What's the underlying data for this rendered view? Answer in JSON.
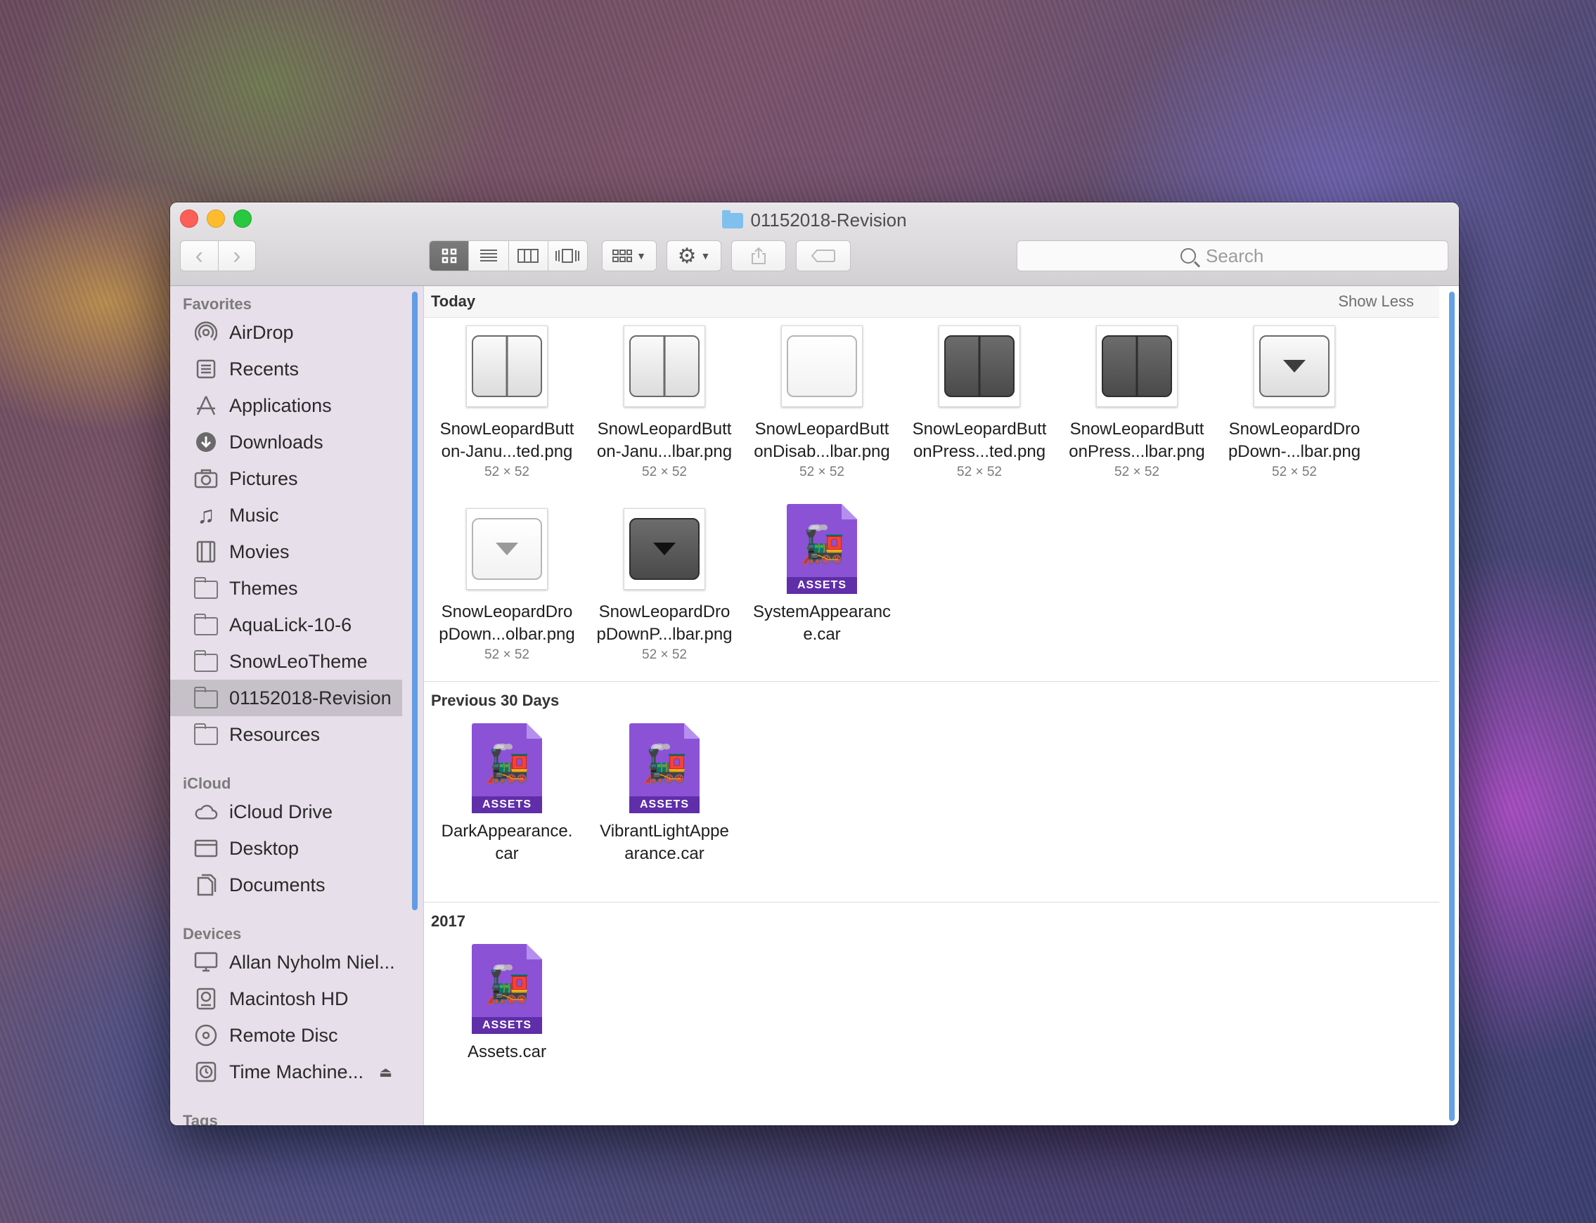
{
  "window": {
    "title": "01152018-Revision"
  },
  "toolbar": {
    "back_label": "‹",
    "forward_label": "›",
    "search_placeholder": "Search"
  },
  "sidebar": {
    "favorites_heading": "Favorites",
    "favorites": [
      {
        "label": "AirDrop",
        "icon": "airdrop-icon"
      },
      {
        "label": "Recents",
        "icon": "recents-icon"
      },
      {
        "label": "Applications",
        "icon": "applications-icon"
      },
      {
        "label": "Downloads",
        "icon": "downloads-icon"
      },
      {
        "label": "Pictures",
        "icon": "camera-icon"
      },
      {
        "label": "Music",
        "icon": "music-icon"
      },
      {
        "label": "Movies",
        "icon": "film-icon"
      },
      {
        "label": "Themes",
        "icon": "folder-icon"
      },
      {
        "label": "AquaLick-10-6",
        "icon": "folder-icon"
      },
      {
        "label": "SnowLeoTheme",
        "icon": "folder-icon"
      },
      {
        "label": "01152018-Revision",
        "icon": "folder-icon",
        "selected": true
      },
      {
        "label": "Resources",
        "icon": "folder-icon"
      }
    ],
    "icloud_heading": "iCloud",
    "icloud": [
      {
        "label": "iCloud Drive",
        "icon": "cloud-icon"
      },
      {
        "label": "Desktop",
        "icon": "desktop-icon"
      },
      {
        "label": "Documents",
        "icon": "documents-icon"
      }
    ],
    "devices_heading": "Devices",
    "devices": [
      {
        "label": "Allan Nyholm Niel...",
        "icon": "computer-icon"
      },
      {
        "label": "Macintosh HD",
        "icon": "hard-drive-icon"
      },
      {
        "label": "Remote Disc",
        "icon": "disc-icon"
      },
      {
        "label": "Time Machine...",
        "icon": "time-machine-icon"
      }
    ],
    "tags_heading": "Tags"
  },
  "groups": {
    "today": {
      "title": "Today",
      "show_less": "Show Less",
      "files": [
        {
          "name1": "SnowLeopardButt",
          "name2": "on-Janu...ted.png",
          "dims": "52 × 52"
        },
        {
          "name1": "SnowLeopardButt",
          "name2": "on-Janu...lbar.png",
          "dims": "52 × 52"
        },
        {
          "name1": "SnowLeopardButt",
          "name2": "onDisab...lbar.png",
          "dims": "52 × 52"
        },
        {
          "name1": "SnowLeopardButt",
          "name2": "onPress...ted.png",
          "dims": "52 × 52"
        },
        {
          "name1": "SnowLeopardButt",
          "name2": "onPress...lbar.png",
          "dims": "52 × 52"
        },
        {
          "name1": "SnowLeopardDro",
          "name2": "pDown-...lbar.png",
          "dims": "52 × 52"
        },
        {
          "name1": "SnowLeopardDro",
          "name2": "pDown...olbar.png",
          "dims": "52 × 52"
        },
        {
          "name1": "SnowLeopardDro",
          "name2": "pDownP...lbar.png",
          "dims": "52 × 52"
        },
        {
          "name1": "SystemAppearanc",
          "name2": "e.car",
          "dims": ""
        }
      ]
    },
    "previous30": {
      "title": "Previous 30 Days",
      "files": [
        {
          "name1": "DarkAppearance.",
          "name2": "car"
        },
        {
          "name1": "VibrantLightAppe",
          "name2": "arance.car"
        }
      ]
    },
    "year2017": {
      "title": "2017",
      "files": [
        {
          "name1": "Assets.car",
          "name2": ""
        }
      ]
    }
  },
  "assets_badge": "ASSETS"
}
